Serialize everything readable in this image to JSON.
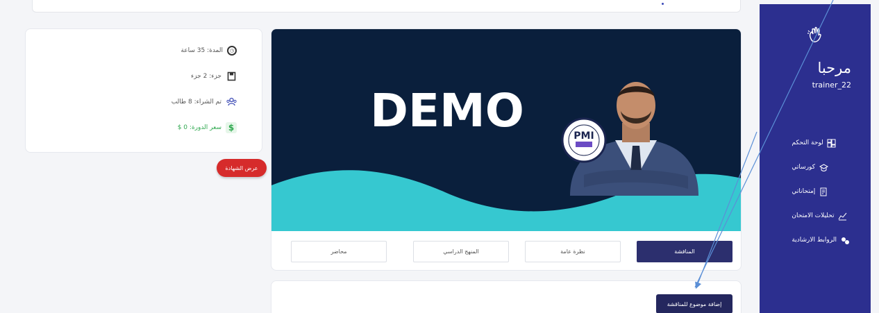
{
  "sidebar": {
    "welcome": "مرحبا",
    "username": "trainer_22",
    "items": [
      {
        "label": "لوحة التحكم",
        "icon": "dashboard-icon"
      },
      {
        "label": "كورساتي",
        "icon": "graduation-cap-icon"
      },
      {
        "label": "إمتحاناتي",
        "icon": "exam-icon"
      },
      {
        "label": "تحليلات الامتحان",
        "icon": "analytics-icon"
      },
      {
        "label": "الروابط الارشادية",
        "icon": "link-icon"
      }
    ]
  },
  "course_info": {
    "duration": "المدة: 35 ساعة",
    "parts": "جزء: 2 جزء",
    "purchased": "تم الشراء: 8 طالب",
    "price": "سعر الدورة: 0 $"
  },
  "certificate_button": "عرض الشهادة",
  "banner": {
    "text": "DEMO",
    "badge_text": "PMI"
  },
  "tabs": [
    {
      "label": "المناقشة",
      "active": true
    },
    {
      "label": "نظرة عامة",
      "active": false
    },
    {
      "label": "المنهج الدراسي",
      "active": false
    },
    {
      "label": "محاضر",
      "active": false
    }
  ],
  "add_topic_button": "إضافة موضوع للمناقشة",
  "colors": {
    "sidebar": "#2c2f8f",
    "banner_navy": "#0a1f3c",
    "banner_teal": "#36c8d0",
    "active_tab": "#2c2f6e",
    "cert_button": "#d62b2b",
    "annotation": "#5b8fd6"
  }
}
